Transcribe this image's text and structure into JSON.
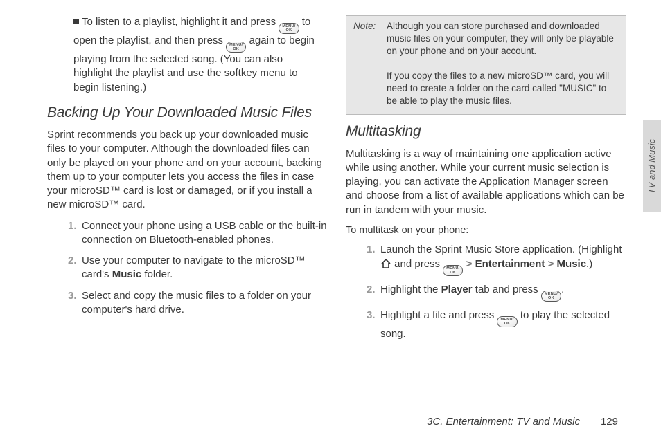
{
  "col1": {
    "bullet": {
      "t1": "To listen to a playlist, highlight it and press ",
      "t2": " to open the playlist, and then press ",
      "t3": " again to begin playing from the selected song. (You can also highlight the playlist and use the softkey menu to begin listening.)"
    },
    "h1": "Backing Up Your Downloaded Music Files",
    "p1": "Sprint recommends you back up your downloaded music files to your computer. Although the downloaded files can only be played on your phone and on your account, backing them up to your computer lets you access the files in case your microSD™ card is lost or damaged, or if you install a new microSD™ card.",
    "s1": "Connect your phone using a USB cable or the built-in connection on Bluetooth-enabled phones.",
    "s2a": "Use your computer to navigate to the microSD™ card's ",
    "s2b": "Music",
    "s2c": " folder.",
    "s3": "Select and copy the music files to a folder on your computer's hard drive."
  },
  "col2": {
    "note_label": "Note:",
    "note1": "Although you can store purchased and downloaded music files on your computer, they will only be playable on your phone and on your account.",
    "note2": "If you copy the files to a new microSD™ card, you will need to create a folder on the card called \"MUSIC\" to be able to play the music files.",
    "h2": "Multitasking",
    "p2": "Multitasking is a way of maintaining one application active while using another. While your current music selection is playing, you can activate the Application Manager screen and choose from a list of available applications which can be run in tandem with your music.",
    "lead": "To multitask on your phone:",
    "s1a": "Launch the Sprint Music Store application. (Highlight ",
    "s1b": " and press ",
    "s1c": "Entertainment",
    "s1d": "Music",
    "s2a": "Highlight the ",
    "s2b": "Player",
    "s2c": " tab and press ",
    "s3a": "Highlight a file and press ",
    "s3b": " to play the selected song."
  },
  "side_tab": "TV and Music",
  "footer_title": "3C. Entertainment: TV and Music",
  "footer_page": "129",
  "icon": {
    "menu": "MENU/",
    "ok": "OK"
  }
}
